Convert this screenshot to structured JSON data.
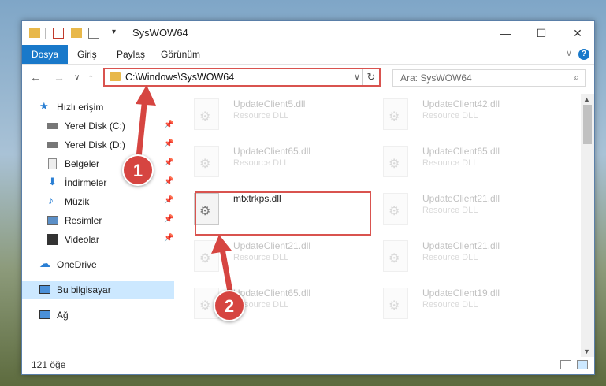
{
  "window": {
    "title": "SysWOW64",
    "controls": {
      "minimize": "—",
      "maximize": "☐",
      "close": "✕"
    }
  },
  "ribbon": {
    "tabs": [
      {
        "label": "Dosya",
        "active": true
      },
      {
        "label": "Giriş"
      },
      {
        "label": "Paylaş"
      },
      {
        "label": "Görünüm"
      }
    ]
  },
  "nav": {
    "address": "C:\\Windows\\SysWOW64",
    "search_placeholder": "Ara: SysWOW64"
  },
  "sidebar": {
    "items": [
      {
        "label": "Hızlı erişim",
        "icon": "star-icon",
        "pinned": false
      },
      {
        "label": "Yerel Disk (C:)",
        "icon": "drive-icon",
        "pinned": true
      },
      {
        "label": "Yerel Disk (D:)",
        "icon": "drive-icon",
        "pinned": true
      },
      {
        "label": "Belgeler",
        "icon": "documents-icon",
        "pinned": true
      },
      {
        "label": "İndirmeler",
        "icon": "download-icon",
        "pinned": true
      },
      {
        "label": "Müzik",
        "icon": "music-icon",
        "pinned": true
      },
      {
        "label": "Resimler",
        "icon": "pictures-icon",
        "pinned": true
      },
      {
        "label": "Videolar",
        "icon": "video-icon",
        "pinned": true
      },
      {
        "label": "OneDrive",
        "icon": "cloud-icon",
        "pinned": false
      },
      {
        "label": "Bu bilgisayar",
        "icon": "computer-icon",
        "pinned": false,
        "selected": true
      },
      {
        "label": "Ağ",
        "icon": "network-icon",
        "pinned": false
      }
    ]
  },
  "files": [
    {
      "name": "UpdateClient5.dll",
      "desc": "Resource DLL",
      "faded": true
    },
    {
      "name": "UpdateClient42.dll",
      "desc": "Resource DLL",
      "faded": true
    },
    {
      "name": "UpdateClient65.dll",
      "desc": "Resource DLL",
      "faded": true
    },
    {
      "name": "UpdateClient65.dll",
      "desc": "Resource DLL",
      "faded": true
    },
    {
      "name": "mtxtrkps.dll",
      "desc": "",
      "faded": false
    },
    {
      "name": "UpdateClient21.dll",
      "desc": "Resource DLL",
      "faded": true
    },
    {
      "name": "UpdateClient21.dll",
      "desc": "Resource DLL",
      "faded": true
    },
    {
      "name": "UpdateClient21.dll",
      "desc": "Resource DLL",
      "faded": true
    },
    {
      "name": "UpdateClient65.dll",
      "desc": "Resource DLL",
      "faded": true
    },
    {
      "name": "UpdateClient19.dll",
      "desc": "Resource DLL",
      "faded": true
    }
  ],
  "status": {
    "count": "121 öğe"
  },
  "callouts": [
    "1",
    "2"
  ],
  "colors": {
    "accent": "#1979ca",
    "highlight": "#d9534f",
    "selected": "#cce8ff"
  }
}
